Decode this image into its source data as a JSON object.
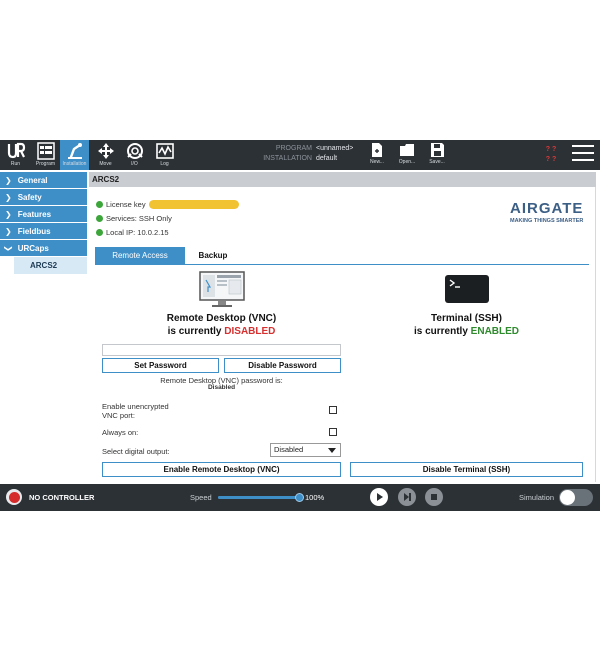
{
  "header": {
    "nav": [
      {
        "label": "Run",
        "icon": "ur-logo-icon"
      },
      {
        "label": "Program",
        "icon": "program-icon"
      },
      {
        "label": "Installation",
        "icon": "installation-icon",
        "active": true
      },
      {
        "label": "Move",
        "icon": "move-icon"
      },
      {
        "label": "I/O",
        "icon": "io-icon"
      },
      {
        "label": "Log",
        "icon": "log-icon"
      }
    ],
    "program_key": "PROGRAM",
    "program_value": "<unnamed>",
    "installation_key": "INSTALLATION",
    "installation_value": "default",
    "file_buttons": [
      {
        "label": "New...",
        "icon": "new-file-icon"
      },
      {
        "label": "Open...",
        "icon": "open-folder-icon"
      },
      {
        "label": "Save...",
        "icon": "save-icon"
      }
    ],
    "alerts_text": "? ?\n? ?",
    "menu_icon": "hamburger-menu-icon"
  },
  "sidebar": {
    "items": [
      {
        "label": "General"
      },
      {
        "label": "Safety"
      },
      {
        "label": "Features"
      },
      {
        "label": "Fieldbus"
      },
      {
        "label": "URCaps",
        "expanded": true
      }
    ],
    "sub_item": "ARCS2"
  },
  "content": {
    "title": "ARCS2",
    "status": {
      "license_label": "License key",
      "services": "Services: SSH Only",
      "local_ip": "Local IP: 10.0.2.15"
    },
    "logo": {
      "brand": "AIRGATE",
      "tagline": "MAKING THINGS SMARTER"
    },
    "tabs": [
      {
        "label": "Remote Access",
        "active": true
      },
      {
        "label": "Backup",
        "active": false
      }
    ],
    "vnc": {
      "title_line1": "Remote Desktop (VNC)",
      "title_prefix": "is currently ",
      "state": "DISABLED",
      "set_password": "Set Password",
      "disable_password": "Disable Password",
      "password_status_label": "Remote Desktop (VNC) password is:",
      "password_status_value": "Disabled",
      "unencrypted_label": "Enable unencrypted\nVNC port:",
      "always_on_label": "Always on:",
      "digital_output_label": "Select digital output:",
      "digital_output_value": "Disabled",
      "enable_button": "Enable Remote Desktop (VNC)"
    },
    "ssh": {
      "title_line1": "Terminal (SSH)",
      "title_prefix": "is currently ",
      "state": "ENABLED",
      "disable_button": "Disable Terminal (SSH)"
    }
  },
  "footer": {
    "controller_status": "NO CONTROLLER",
    "speed_label": "Speed",
    "speed_value": "100%",
    "speed_fraction": 1.0,
    "simulation_label": "Simulation",
    "colors": {
      "accent": "#3e8fc8",
      "danger": "#d62b2b",
      "success": "#2f8a2e"
    }
  }
}
